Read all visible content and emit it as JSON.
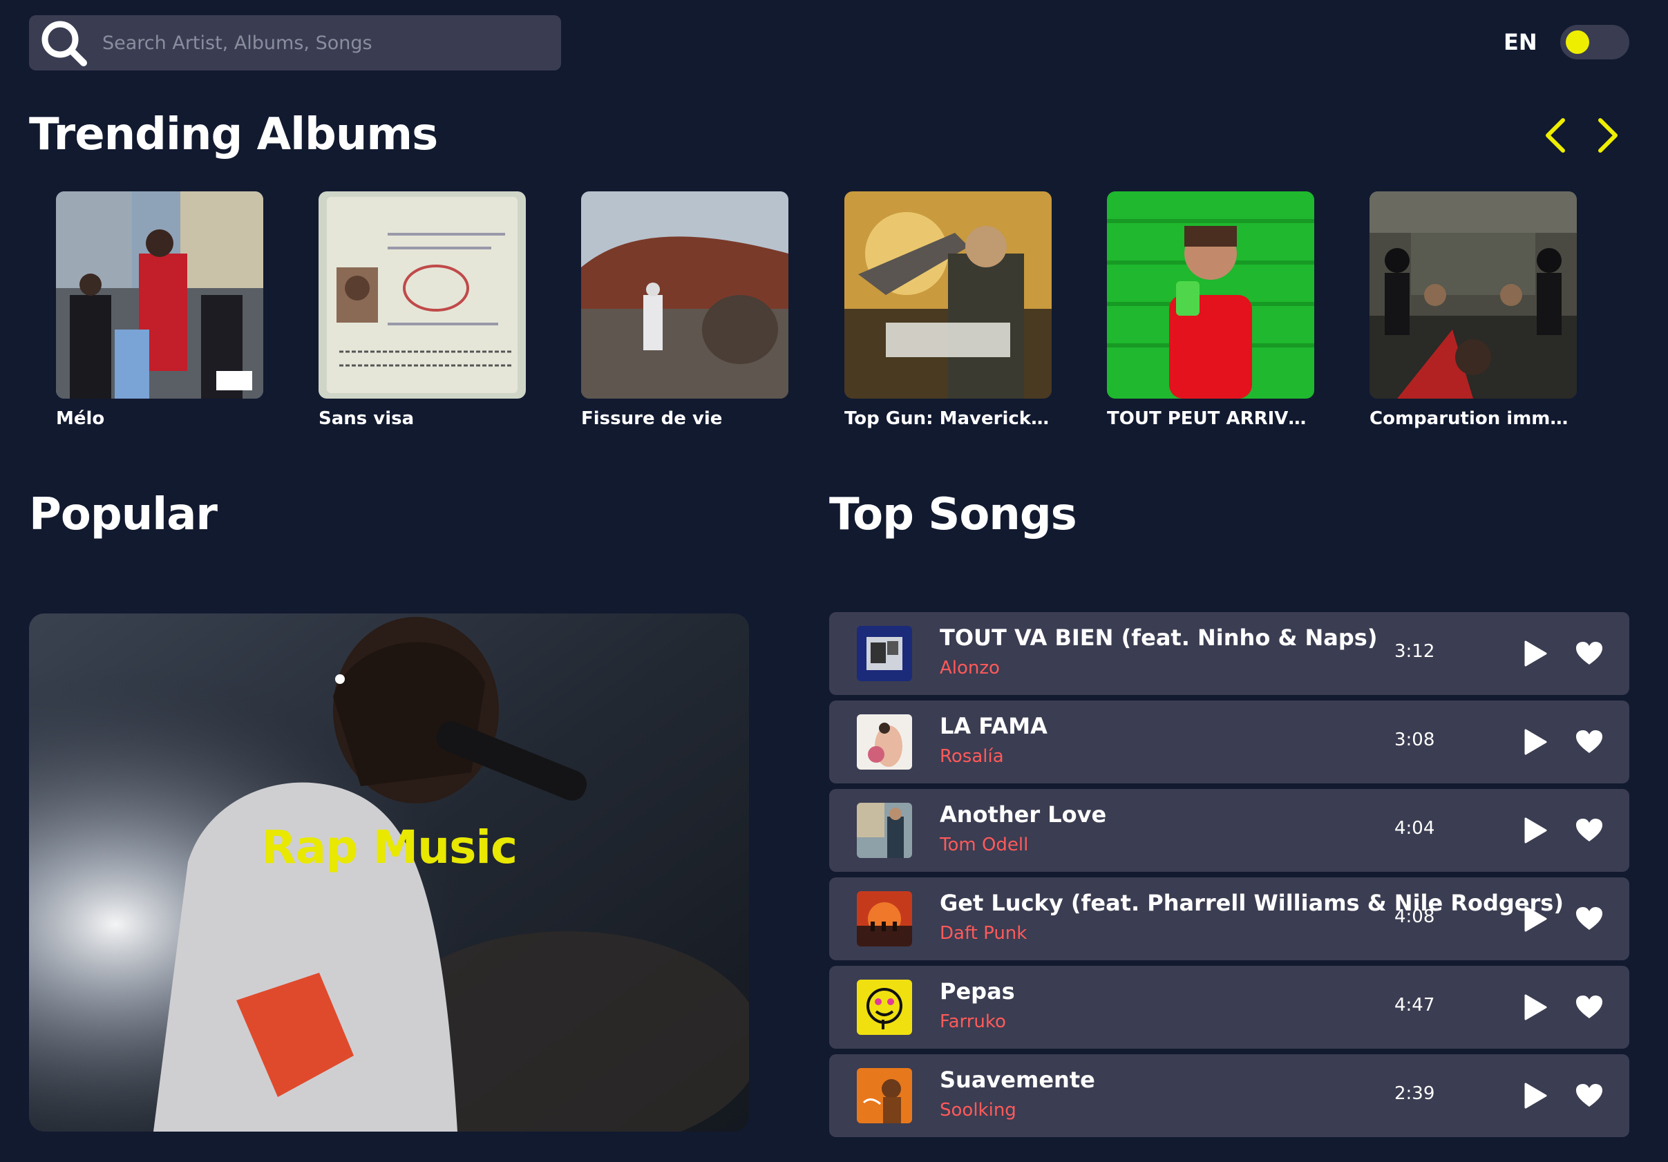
{
  "search": {
    "placeholder": "Search Artist, Albums, Songs"
  },
  "language": "EN",
  "colors": {
    "background": "#121a30",
    "panel": "#3b3d52",
    "accent": "#eeee00",
    "artist": "#ff5a5a"
  },
  "trending": {
    "title": "Trending Albums",
    "albums": [
      {
        "title": "Mélo"
      },
      {
        "title": "Sans visa"
      },
      {
        "title": "Fissure de vie"
      },
      {
        "title": "Top Gun: Maverick (..."
      },
      {
        "title": "TOUT PEUT ARRIVER"
      },
      {
        "title": "Comparution imméd..."
      }
    ]
  },
  "popular": {
    "title": "Popular",
    "card_label": "Rap Music"
  },
  "top_songs": {
    "title": "Top Songs",
    "songs": [
      {
        "title": "TOUT VA BIEN (feat. Ninho & Naps)",
        "artist": "Alonzo",
        "duration": "3:12"
      },
      {
        "title": "LA FAMA",
        "artist": "Rosalía",
        "duration": "3:08"
      },
      {
        "title": "Another Love",
        "artist": "Tom Odell",
        "duration": "4:04"
      },
      {
        "title": "Get Lucky (feat. Pharrell Williams & Nile Rodgers)",
        "artist": "Daft Punk",
        "duration": "4:08"
      },
      {
        "title": "Pepas",
        "artist": "Farruko",
        "duration": "4:47"
      },
      {
        "title": "Suavemente",
        "artist": "Soolking",
        "duration": "2:39"
      }
    ]
  }
}
